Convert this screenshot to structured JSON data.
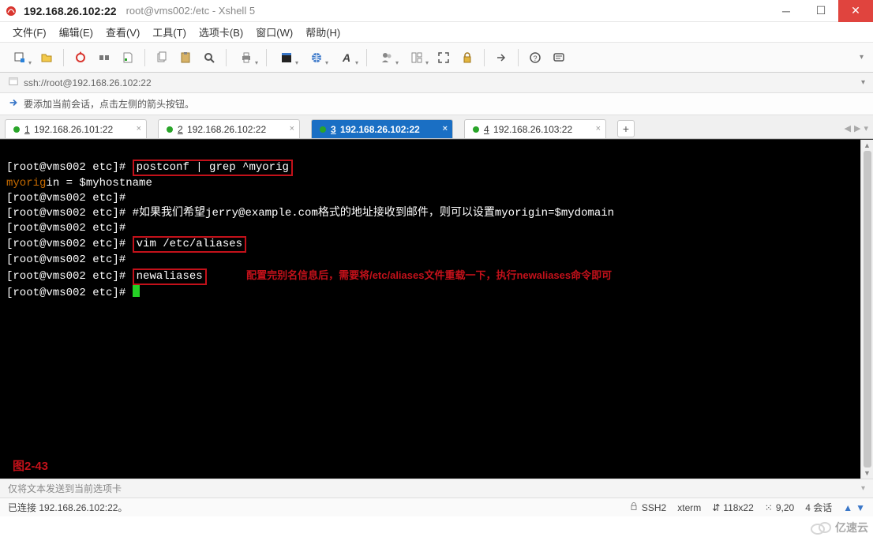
{
  "window": {
    "address": "192.168.26.102:22",
    "subtitle": "root@vms002:/etc - Xshell 5"
  },
  "menu": {
    "file": "文件(F)",
    "edit": "编辑(E)",
    "view": "查看(V)",
    "tool": "工具(T)",
    "tab": "选项卡(B)",
    "window": "窗口(W)",
    "help": "帮助(H)"
  },
  "toolbar_icons": {
    "new_session": "new-session-icon",
    "open": "open-icon",
    "save": "save-icon",
    "properties": "properties-icon",
    "copy": "copy-icon",
    "paste": "paste-icon",
    "find": "search-icon",
    "print": "print-icon",
    "color": "color-scheme-icon",
    "encoding": "globe-encoding-icon",
    "font": "font-icon",
    "users": "users-icon",
    "layout": "layout-icon",
    "fullscreen": "fullscreen-icon",
    "lock": "lock-icon",
    "arrow": "arrow-right-icon",
    "help": "help-icon",
    "history": "history-icon"
  },
  "addressbar": {
    "url": "ssh://root@192.168.26.102:22"
  },
  "hint": {
    "text": "要添加当前会话，点击左侧的箭头按钮。"
  },
  "tabs": [
    {
      "num": "1",
      "label": "192.168.26.101:22",
      "active": false
    },
    {
      "num": "2",
      "label": "192.168.26.102:22",
      "active": false
    },
    {
      "num": "3",
      "label": "192.168.26.102:22",
      "active": true
    },
    {
      "num": "4",
      "label": "192.168.26.103:22",
      "active": false
    }
  ],
  "terminal": {
    "prompt": "[root@vms002 etc]#",
    "cmd_postconf": "postconf | grep ^myorig",
    "out_myorigin_left": "myorig",
    "out_myorigin_right": "in = $myhostname",
    "cmd_comment": "#如果我们希望jerry@example.com格式的地址接收到邮件，则可以设置myorigin=$mydomain",
    "cmd_vim": "vim /etc/aliases",
    "cmd_newaliases": "newaliases",
    "annotation": "配置完别名信息后，需要将/etc/aliases文件重载一下，执行newaliases命令即可",
    "fig_label": "图2-43"
  },
  "sendbar": {
    "placeholder": "仅将文本发送到当前选项卡"
  },
  "status": {
    "left": "已连接 192.168.26.102:22。",
    "protocol": "SSH2",
    "term": "xterm",
    "size": "118x22",
    "cursor": "9,20",
    "sessions": "4 会话"
  },
  "watermark": "亿速云"
}
